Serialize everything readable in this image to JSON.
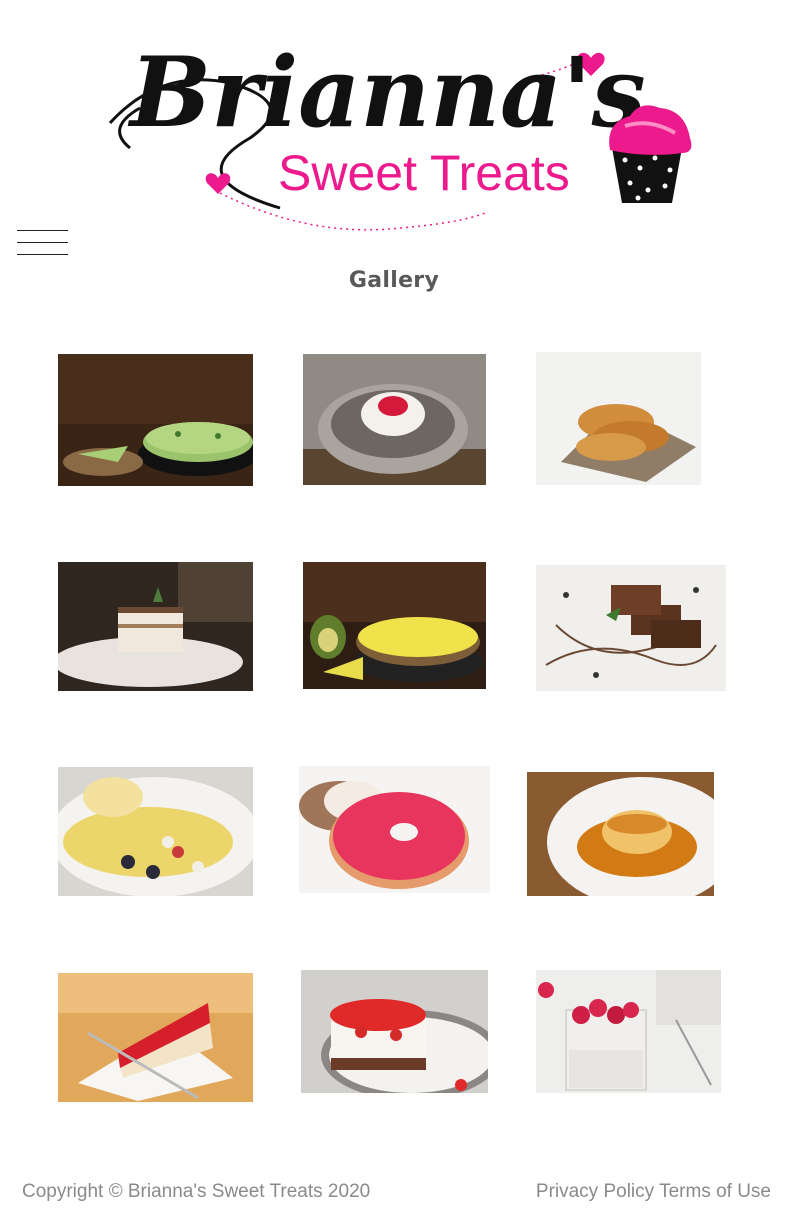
{
  "logo": {
    "name_script": "Brianna's",
    "tagline": "Sweet Treats",
    "alt": "Brianna's Sweet Treats"
  },
  "nav": {
    "menu_icon": "hamburger-menu-icon"
  },
  "page": {
    "title": "Gallery"
  },
  "gallery": {
    "images": [
      {
        "name": "matcha-cheesecake-photo"
      },
      {
        "name": "panna-cotta-photo"
      },
      {
        "name": "croissants-photo"
      },
      {
        "name": "tiramisu-photo"
      },
      {
        "name": "lemon-cheesecake-photo"
      },
      {
        "name": "brownies-photo"
      },
      {
        "name": "fruit-crepe-photo"
      },
      {
        "name": "pink-donut-photo"
      },
      {
        "name": "flan-photo"
      },
      {
        "name": "strawberry-cheesecake-slice-photo"
      },
      {
        "name": "strawberry-cake-photo"
      },
      {
        "name": "raspberry-chia-pudding-photo"
      }
    ]
  },
  "footer": {
    "copyright": "Copyright © Brianna's Sweet Treats 2020",
    "privacy_label": "Privacy Policy",
    "terms_label": "Terms of Use"
  },
  "colors": {
    "brand_pink": "#ec1a8c",
    "title_gray": "#595959",
    "footer_gray": "#8a8a8a"
  }
}
